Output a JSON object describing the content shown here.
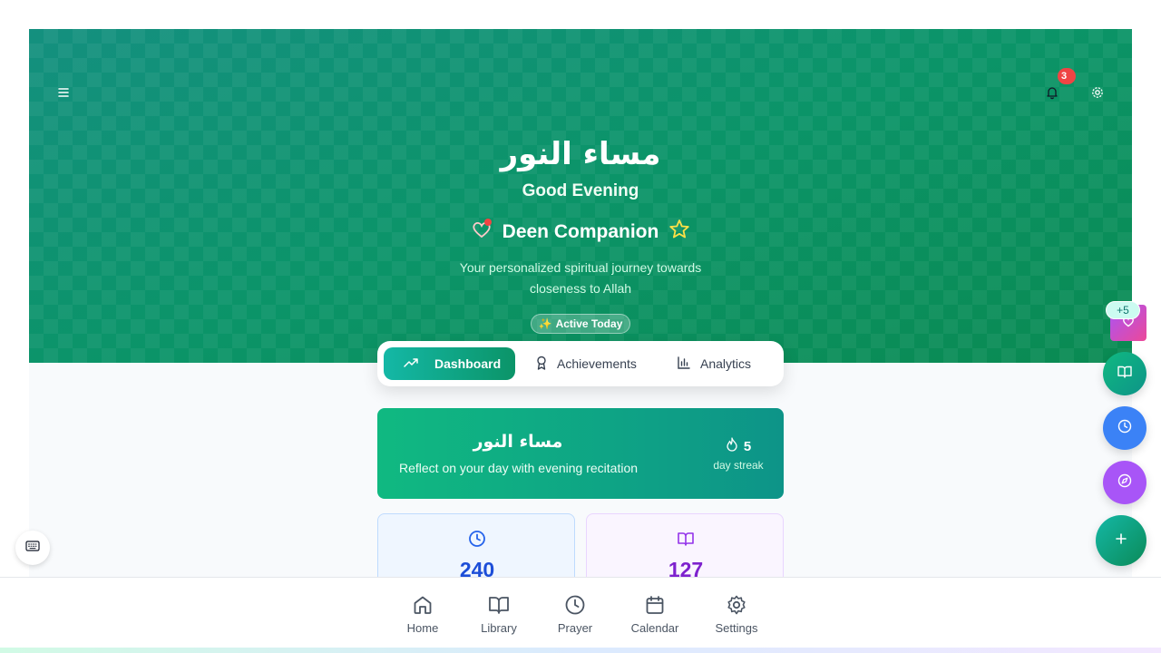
{
  "hero": {
    "arabic_greeting": "مساء النور",
    "greeting": "Good Evening",
    "app_name": "Deen Companion",
    "subtitle_line1": "Your personalized spiritual journey towards",
    "subtitle_line2": "closeness to Allah",
    "active_chip": "Active Today",
    "active_chip_emoji": "✨",
    "notification_count": "3"
  },
  "tabs": [
    {
      "label": "Dashboard",
      "icon": "trending-up-icon",
      "active": true
    },
    {
      "label": "Achievements",
      "icon": "award-icon",
      "active": false
    },
    {
      "label": "Analytics",
      "icon": "bar-chart-icon",
      "active": false
    }
  ],
  "greeting_card": {
    "arabic_title": "مساء النور",
    "description": "Reflect on your day with evening recitation",
    "streak_value": "5",
    "streak_label": "day streak"
  },
  "stats": [
    {
      "value": "240",
      "icon": "clock-icon",
      "color": "#1d4ed8"
    },
    {
      "value": "127",
      "icon": "book-open-icon",
      "color": "#7e22ce"
    }
  ],
  "floating": {
    "plus_badge": "+5",
    "buttons": [
      {
        "icon": "heart-icon",
        "color": "#ec4899"
      },
      {
        "icon": "book-open-icon",
        "color": "#10b981"
      },
      {
        "icon": "clock-icon",
        "color": "#3b82f6"
      },
      {
        "icon": "compass-icon",
        "color": "#a855f7"
      },
      {
        "icon": "plus-icon",
        "color": "#0d9488"
      }
    ]
  },
  "bottom_nav": [
    {
      "label": "Home",
      "icon": "home-icon"
    },
    {
      "label": "Library",
      "icon": "book-open-icon"
    },
    {
      "label": "Prayer",
      "icon": "clock-icon"
    },
    {
      "label": "Calendar",
      "icon": "calendar-icon"
    },
    {
      "label": "Settings",
      "icon": "gear-icon"
    }
  ],
  "colors": {
    "primary": "#0b9468",
    "accent_teal": "#14b8a6",
    "badge_red": "#ef4444"
  }
}
